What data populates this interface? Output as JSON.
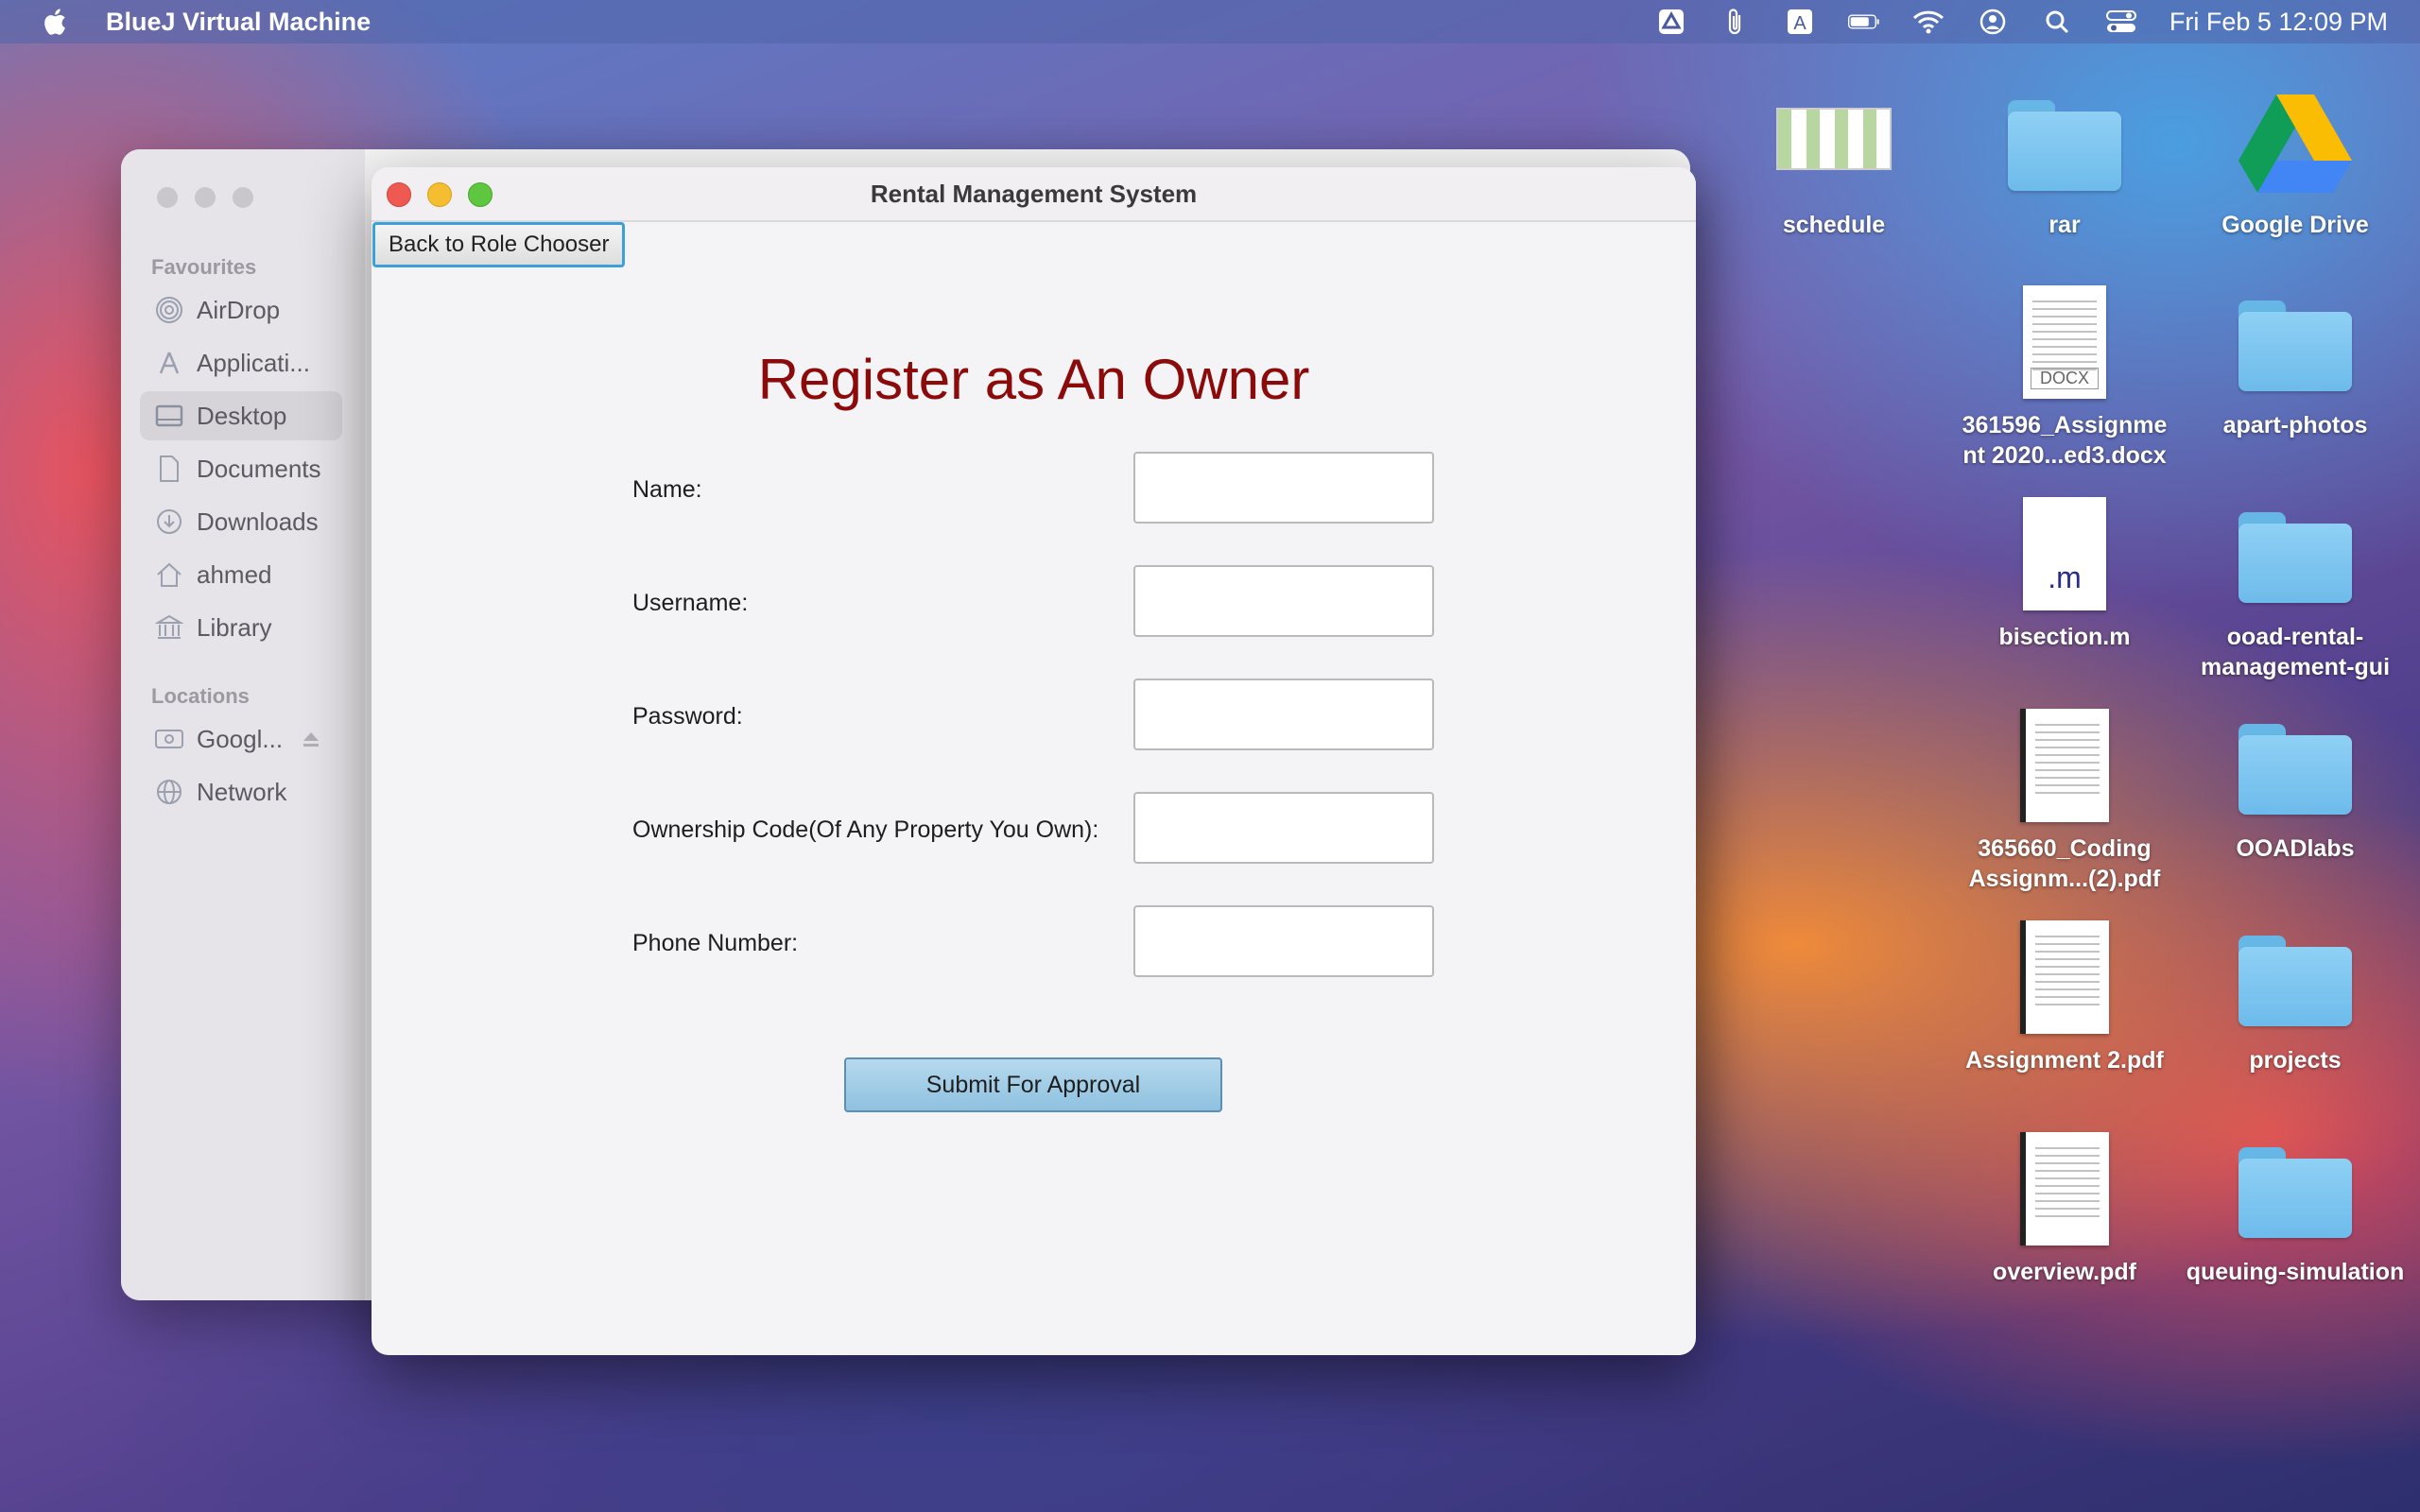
{
  "menubar": {
    "app_name": "BlueJ Virtual Machine",
    "clock": "Fri Feb 5  12:09 PM",
    "icons": [
      "apple-icon",
      "drive-sync-icon",
      "paperclip-icon",
      "keyboard-input-icon",
      "battery-icon",
      "wifi-icon",
      "user-icon",
      "search-icon",
      "control-center-icon"
    ]
  },
  "finder": {
    "favourites_label": "Favourites",
    "locations_label": "Locations",
    "items": [
      {
        "label": "AirDrop",
        "icon": "airdrop-icon"
      },
      {
        "label": "Applicati...",
        "icon": "applications-icon"
      },
      {
        "label": "Desktop",
        "icon": "desktop-icon",
        "active": true
      },
      {
        "label": "Documents",
        "icon": "document-icon"
      },
      {
        "label": "Downloads",
        "icon": "download-icon"
      },
      {
        "label": "ahmed",
        "icon": "home-icon"
      },
      {
        "label": "Library",
        "icon": "library-icon"
      }
    ],
    "locations": [
      {
        "label": "Googl...",
        "icon": "drive-icon"
      },
      {
        "label": "Network",
        "icon": "network-icon"
      }
    ]
  },
  "window": {
    "title": "Rental Management System",
    "back_button": "Back to Role Chooser",
    "heading": "Register as An Owner",
    "fields": [
      {
        "label": "Name:",
        "value": ""
      },
      {
        "label": "Username:",
        "value": ""
      },
      {
        "label": "Password:",
        "value": ""
      },
      {
        "label": "Ownership Code(Of Any Property You Own):",
        "value": ""
      },
      {
        "label": "Phone Number:",
        "value": ""
      }
    ],
    "submit_button": "Submit For Approval"
  },
  "desktop": {
    "icons": [
      {
        "name": "schedule",
        "type": "image"
      },
      {
        "name": "rar",
        "type": "folder"
      },
      {
        "name": "Google Drive",
        "type": "drive"
      },
      {
        "name": "361596_Assignme nt 2020...ed3.docx",
        "type": "docx"
      },
      {
        "name": "apart-photos",
        "type": "folder"
      },
      {
        "name": "bisection.m",
        "type": "m-file"
      },
      {
        "name": "ooad-rental-management-gui",
        "type": "folder"
      },
      {
        "name": "365660_Coding Assignm...(2).pdf",
        "type": "pdf"
      },
      {
        "name": "OOADlabs",
        "type": "folder"
      },
      {
        "name": "Assignment 2.pdf",
        "type": "pdf"
      },
      {
        "name": "projects",
        "type": "folder"
      },
      {
        "name": "overview.pdf",
        "type": "pdf"
      },
      {
        "name": "queuing-simulation",
        "type": "folder"
      }
    ]
  }
}
